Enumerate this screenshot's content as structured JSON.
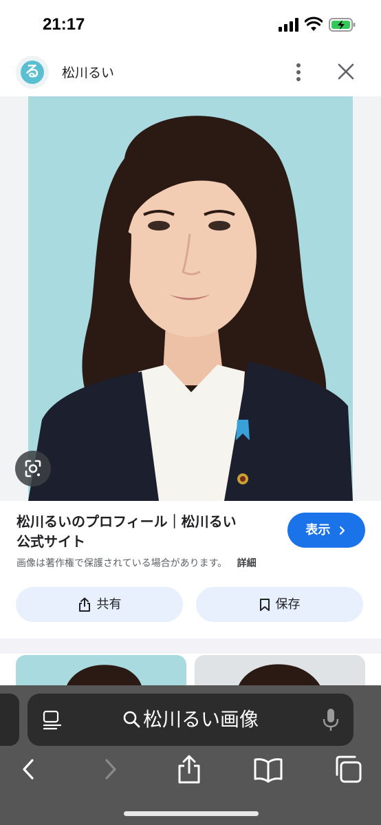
{
  "status": {
    "time": "21:17"
  },
  "header": {
    "site_icon_glyph": "る",
    "site_name": "松川るい"
  },
  "result": {
    "title_line1": "松川るいのプロフィール｜松川るい",
    "title_line2": "公式サイト",
    "view_button": "表示",
    "copyright_note": "画像は著作権で保護されている場合があります。",
    "detail_link": "詳細",
    "share_button": "共有",
    "save_button": "保存"
  },
  "browser": {
    "address_text": "松川るい画像"
  },
  "colors": {
    "accent": "#1a73e8",
    "pill_bg": "#e8f0fe",
    "battery": "#34c759",
    "photo_bg": "#a9dadf"
  }
}
